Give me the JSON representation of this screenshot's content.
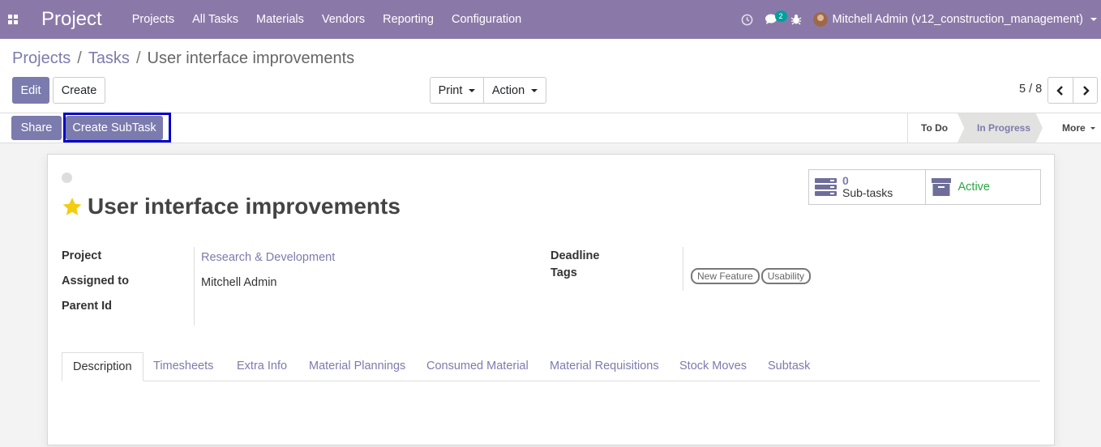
{
  "app": {
    "name": "Project"
  },
  "menu": [
    "Projects",
    "All Tasks",
    "Materials",
    "Vendors",
    "Reporting",
    "Configuration"
  ],
  "systray": {
    "messages_count": "2",
    "user": "Mitchell Admin (v12_construction_management)"
  },
  "breadcrumb": {
    "item1": "Projects",
    "sep": "/",
    "item2": "Tasks",
    "current": "User interface improvements"
  },
  "buttons": {
    "edit": "Edit",
    "create": "Create",
    "print": "Print",
    "action": "Action",
    "share": "Share",
    "create_subtask": "Create SubTask"
  },
  "pager": {
    "value": "5 / 8"
  },
  "stages": {
    "todo": "To Do",
    "in_progress": "In Progress",
    "more": "More"
  },
  "task": {
    "title": "User interface improvements",
    "starred": true
  },
  "smart_buttons": {
    "subtasks_count": "0",
    "subtasks_label": "Sub-tasks",
    "active": "Active"
  },
  "fields": {
    "project_label": "Project",
    "project_value": "Research & Development",
    "assigned_label": "Assigned to",
    "assigned_value": "Mitchell Admin",
    "parent_label": "Parent Id",
    "deadline_label": "Deadline",
    "tags_label": "Tags",
    "tags": [
      "New Feature",
      "Usability"
    ]
  },
  "tabs": [
    "Description",
    "Timesheets",
    "Extra Info",
    "Material Plannings",
    "Consumed Material",
    "Material Requisitions",
    "Stock Moves",
    "Subtask"
  ],
  "colors": {
    "navbar": "#8a79a8",
    "primary": "#7c7bad",
    "active": "#28a745",
    "focus": "#0000c8"
  }
}
